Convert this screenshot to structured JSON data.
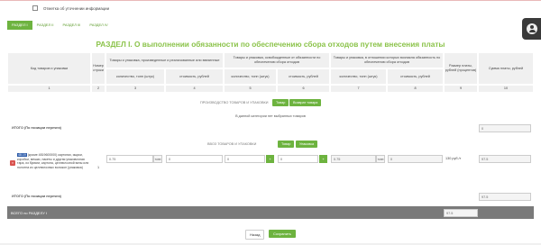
{
  "correction": {
    "label": "Отметка об уточнении информации"
  },
  "tabs": [
    {
      "label": "РАЗДЕЛ I",
      "active": true
    },
    {
      "label": "РАЗДЕЛ II",
      "active": false
    },
    {
      "label": "РАЗДЕЛ III",
      "active": false
    },
    {
      "label": "РАЗДЕЛ IV",
      "active": false
    }
  ],
  "page_title": "РАЗДЕЛ I. О выполнении обязанности по обеспечению сбора отходов путем внесения платы",
  "table": {
    "headers": {
      "code": "Код товаров и упаковки",
      "line_no": "Номер строки",
      "group1": "Товары и упаковка, произведенные и реализованные или ввезенные",
      "group2": "Товары и упаковка, освобожденные от обязанности по обеспечению сбора отходов",
      "group3": "Товары и упаковка, в отношении которых возникла обязанность по обеспечению сбора отходов",
      "qty": "количество, тонн (штук)",
      "cost": "стоимость, рублей",
      "rate": "Размер платы, рублей (процентов)",
      "sum": "Сумма платы, рублей"
    },
    "col_numbers": [
      "1",
      "2",
      "3",
      "4",
      "5",
      "6",
      "7",
      "8",
      "9",
      "10"
    ],
    "production": {
      "label": "ПРОИЗВОДСТВО ТОВАРОВ И УПАКОВКИ",
      "btn_goods": "Товар",
      "btn_return": "Возврат товара",
      "empty_note": "В данной категории нет выбранных товаров",
      "total_label": "ИТОГО (По позиции перечня)",
      "total_value": "0"
    },
    "import": {
      "label": "ВВОЗ ТОВАРОВ И УПАКОВКИ",
      "btn_goods": "Товар",
      "btn_pack": "Упаковка",
      "row": {
        "code": "48.19",
        "description": "(кроме 4819600000) картонки, ящики, коробки, мешки, пакеты и другая упаковочная тара, из бумаги, картона, целлюлозной ваты или полотна из целлюлозных волокон (упаковка)",
        "line_no": "1",
        "qty1": "0.75",
        "unit1": "тонн",
        "cost1": "0",
        "qty2": "0",
        "cost2": "0",
        "qty3": "0.75",
        "unit3": "тонн",
        "cost3": "0",
        "rate": "130 руб./т",
        "sum": "97.5",
        "plus": "+"
      },
      "total_label": "ИТОГО (По позиции перечня)",
      "total_value": "97.5"
    },
    "grand_total_label": "ВСЕГО по РАЗДЕЛУ I",
    "grand_total_value": "97.5"
  },
  "footer": {
    "back": "Назад",
    "save": "Сохранить"
  },
  "colors": {
    "accent": "#6db33f",
    "title": "#8bc34a",
    "dark_row": "#7a7a7a",
    "delete": "#d9534f"
  }
}
